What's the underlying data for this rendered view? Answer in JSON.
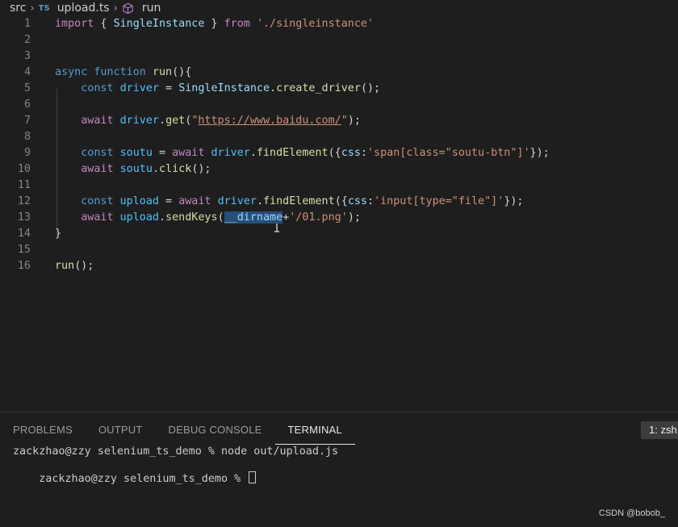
{
  "breadcrumb": {
    "folder": "src",
    "file_badge": "TS",
    "file": "upload.ts",
    "symbol": "run"
  },
  "editor": {
    "lines": [
      {
        "n": "1",
        "tokens": [
          {
            "t": "import",
            "c": "ctl"
          },
          {
            "t": " { ",
            "c": "punc"
          },
          {
            "t": "SingleInstance",
            "c": "var"
          },
          {
            "t": " } ",
            "c": "punc"
          },
          {
            "t": "from",
            "c": "ctl"
          },
          {
            "t": " ",
            "c": "punc"
          },
          {
            "t": "'./singleinstance'",
            "c": "str"
          }
        ]
      },
      {
        "n": "2",
        "tokens": []
      },
      {
        "n": "3",
        "tokens": []
      },
      {
        "n": "4",
        "tokens": [
          {
            "t": "async",
            "c": "kw"
          },
          {
            "t": " ",
            "c": "punc"
          },
          {
            "t": "function",
            "c": "kw"
          },
          {
            "t": " ",
            "c": "punc"
          },
          {
            "t": "run",
            "c": "fn"
          },
          {
            "t": "(){",
            "c": "punc"
          }
        ]
      },
      {
        "n": "5",
        "tokens": [
          {
            "t": "    ",
            "c": "punc"
          },
          {
            "t": "const",
            "c": "kw"
          },
          {
            "t": " ",
            "c": "punc"
          },
          {
            "t": "driver",
            "c": "cst"
          },
          {
            "t": " = ",
            "c": "punc"
          },
          {
            "t": "SingleInstance",
            "c": "var"
          },
          {
            "t": ".",
            "c": "punc"
          },
          {
            "t": "create_driver",
            "c": "fn"
          },
          {
            "t": "();",
            "c": "punc"
          }
        ]
      },
      {
        "n": "6",
        "tokens": []
      },
      {
        "n": "7",
        "tokens": [
          {
            "t": "    ",
            "c": "punc"
          },
          {
            "t": "await",
            "c": "ctl"
          },
          {
            "t": " ",
            "c": "punc"
          },
          {
            "t": "driver",
            "c": "cst"
          },
          {
            "t": ".",
            "c": "punc"
          },
          {
            "t": "get",
            "c": "fn"
          },
          {
            "t": "(",
            "c": "punc"
          },
          {
            "t": "\"",
            "c": "str"
          },
          {
            "t": "https://www.baidu.com/",
            "c": "url"
          },
          {
            "t": "\"",
            "c": "str"
          },
          {
            "t": ");",
            "c": "punc"
          }
        ]
      },
      {
        "n": "8",
        "tokens": []
      },
      {
        "n": "9",
        "tokens": [
          {
            "t": "    ",
            "c": "punc"
          },
          {
            "t": "const",
            "c": "kw"
          },
          {
            "t": " ",
            "c": "punc"
          },
          {
            "t": "soutu",
            "c": "cst"
          },
          {
            "t": " = ",
            "c": "punc"
          },
          {
            "t": "await",
            "c": "ctl"
          },
          {
            "t": " ",
            "c": "punc"
          },
          {
            "t": "driver",
            "c": "cst"
          },
          {
            "t": ".",
            "c": "punc"
          },
          {
            "t": "findElement",
            "c": "fn"
          },
          {
            "t": "({",
            "c": "punc"
          },
          {
            "t": "css",
            "c": "var"
          },
          {
            "t": ":",
            "c": "punc"
          },
          {
            "t": "'span[class=\"soutu-btn\"]'",
            "c": "str"
          },
          {
            "t": "});",
            "c": "punc"
          }
        ]
      },
      {
        "n": "10",
        "tokens": [
          {
            "t": "    ",
            "c": "punc"
          },
          {
            "t": "await",
            "c": "ctl"
          },
          {
            "t": " ",
            "c": "punc"
          },
          {
            "t": "soutu",
            "c": "cst"
          },
          {
            "t": ".",
            "c": "punc"
          },
          {
            "t": "click",
            "c": "fn"
          },
          {
            "t": "();",
            "c": "punc"
          }
        ]
      },
      {
        "n": "11",
        "tokens": []
      },
      {
        "n": "12",
        "tokens": [
          {
            "t": "    ",
            "c": "punc"
          },
          {
            "t": "const",
            "c": "kw"
          },
          {
            "t": " ",
            "c": "punc"
          },
          {
            "t": "upload",
            "c": "cst"
          },
          {
            "t": " = ",
            "c": "punc"
          },
          {
            "t": "await",
            "c": "ctl"
          },
          {
            "t": " ",
            "c": "punc"
          },
          {
            "t": "driver",
            "c": "cst"
          },
          {
            "t": ".",
            "c": "punc"
          },
          {
            "t": "findElement",
            "c": "fn"
          },
          {
            "t": "({",
            "c": "punc"
          },
          {
            "t": "css",
            "c": "var"
          },
          {
            "t": ":",
            "c": "punc"
          },
          {
            "t": "'input[type=\"file\"]'",
            "c": "str"
          },
          {
            "t": "});",
            "c": "punc"
          }
        ]
      },
      {
        "n": "13",
        "tokens": [
          {
            "t": "    ",
            "c": "punc"
          },
          {
            "t": "await",
            "c": "ctl"
          },
          {
            "t": " ",
            "c": "punc"
          },
          {
            "t": "upload",
            "c": "cst"
          },
          {
            "t": ".",
            "c": "punc"
          },
          {
            "t": "sendKeys",
            "c": "fn"
          },
          {
            "t": "(",
            "c": "punc"
          },
          {
            "t": "__dirname",
            "c": "var sel"
          },
          {
            "t": "+",
            "c": "punc"
          },
          {
            "t": "'/01.png'",
            "c": "str"
          },
          {
            "t": ");",
            "c": "punc"
          }
        ]
      },
      {
        "n": "14",
        "tokens": [
          {
            "t": "}",
            "c": "punc"
          }
        ]
      },
      {
        "n": "15",
        "tokens": []
      },
      {
        "n": "16",
        "tokens": [
          {
            "t": "run",
            "c": "fn"
          },
          {
            "t": "();",
            "c": "punc"
          }
        ]
      }
    ]
  },
  "panel": {
    "tabs": [
      {
        "label": "PROBLEMS",
        "active": false
      },
      {
        "label": "OUTPUT",
        "active": false
      },
      {
        "label": "DEBUG CONSOLE",
        "active": false
      },
      {
        "label": "TERMINAL",
        "active": true
      }
    ],
    "terminal_select": "1: zsh",
    "terminal_lines": [
      "zackzhao@zzy selenium_ts_demo % node out/upload.js",
      "zackzhao@zzy selenium_ts_demo % "
    ]
  },
  "watermark": "CSDN @bobob_"
}
